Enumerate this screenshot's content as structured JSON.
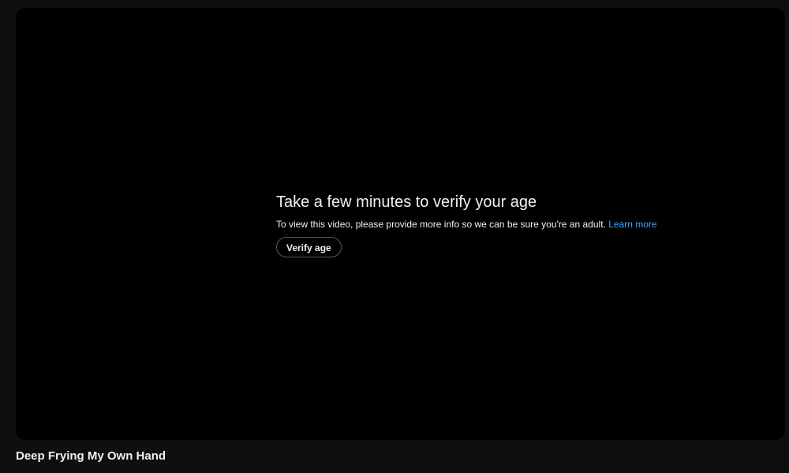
{
  "age_gate": {
    "title": "Take a few minutes to verify your age",
    "message": "To view this video, please provide more info so we can be sure you're an adult.",
    "learn_more_label": "Learn more",
    "verify_button_label": "Verify age"
  },
  "video": {
    "title": "Deep Frying My Own Hand"
  },
  "colors": {
    "page_background": "#0f0f0f",
    "player_background": "#000000",
    "link": "#3ea6ff",
    "text": "#f1f1f1"
  }
}
